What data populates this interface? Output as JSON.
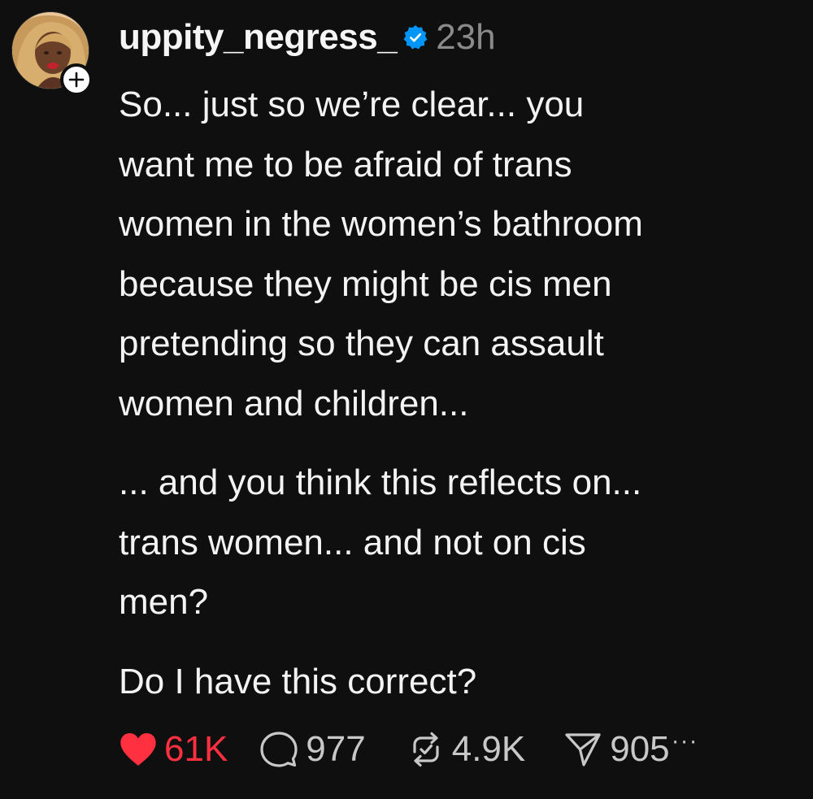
{
  "post": {
    "author": {
      "username": "uppity_negress_",
      "verified": true,
      "avatar": "profile-photo",
      "follow_icon": "plus-icon"
    },
    "timestamp": "23h",
    "paragraphs": [
      "So... just so we’re clear... you\nwant me to be afraid of trans\nwomen in the women’s bathroom\nbecause they might be cis men\npretending so they can assault\nwomen and children...",
      "... and you think this reflects on...\ntrans women... and not on cis\nmen?",
      "Do I have this correct?"
    ],
    "actions": {
      "likes": {
        "icon": "heart-icon",
        "count": "61K",
        "liked": true
      },
      "replies": {
        "icon": "comment-icon",
        "count": "977"
      },
      "reposts": {
        "icon": "repost-icon",
        "count": "4.9K"
      },
      "shares": {
        "icon": "send-icon",
        "count": "905"
      },
      "more": {
        "icon": "more-icon",
        "label": "···"
      }
    }
  },
  "colors": {
    "background": "#0f0f10",
    "text": "#f3f3f3",
    "muted": "#8a8a8a",
    "like": "#ff3040",
    "verified": "#0095f6"
  }
}
